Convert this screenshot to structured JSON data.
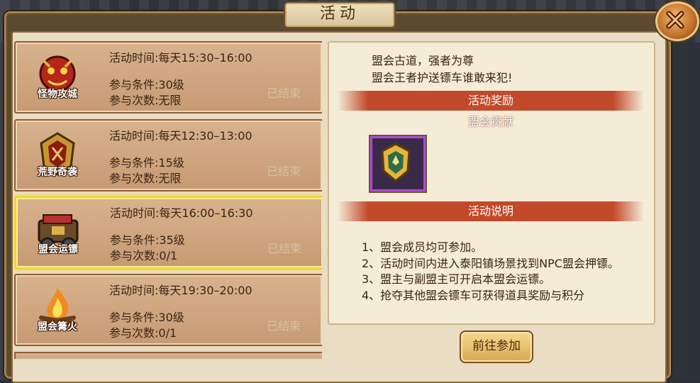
{
  "window": {
    "title": "活动"
  },
  "activities": [
    {
      "icon_name": "monster-siege-icon",
      "icon_label": "怪物攻城",
      "time": "活动时间:每天15:30–16:00",
      "requirement": "参与条件:30级",
      "count": "参与次数:无限",
      "status": "已结束",
      "selected": false
    },
    {
      "icon_name": "wild-escort-icon",
      "icon_label": "荒野奇袭",
      "time": "活动时间:每天12:30–13:00",
      "requirement": "参与条件:15级",
      "count": "参与次数:无限",
      "status": "已结束",
      "selected": false
    },
    {
      "icon_name": "guild-escort-cart-icon",
      "icon_label": "盟会运镖",
      "time": "活动时间:每天16:00–16:30",
      "requirement": "参与条件:35级",
      "count": "参与次数:0/1",
      "status": "已结束",
      "selected": true
    },
    {
      "icon_name": "guild-bonfire-icon",
      "icon_label": "盟会篝火",
      "time": "活动时间:每天19:30–20:00",
      "requirement": "参与条件:30级",
      "count": "参与次数:0/1",
      "status": "已结束",
      "selected": false
    }
  ],
  "detail": {
    "intro_line1": "盟会古道，强者为尊",
    "intro_line2": "盟会王者护送镖车谁敢来犯!",
    "reward_header": "活动奖励",
    "reward_name": "盟会贡献",
    "reward_icon": "guild-token-icon",
    "desc_header": "活动说明",
    "desc_lines": [
      "1、盟会成员均可参加。",
      "2、活动时间内进入泰阳镇场景找到NPC盟会押镖。",
      "3、盟主与副盟主可开启本盟会运镖。",
      "4、抢夺其他盟会镖车可获得道具奖励与积分"
    ]
  },
  "buttons": {
    "join": "前往参加",
    "close_icon": "close-icon"
  },
  "colors": {
    "selected_border": "#f1d33a",
    "banner": "#c24a2a",
    "reward_border": "#b04ad8"
  }
}
